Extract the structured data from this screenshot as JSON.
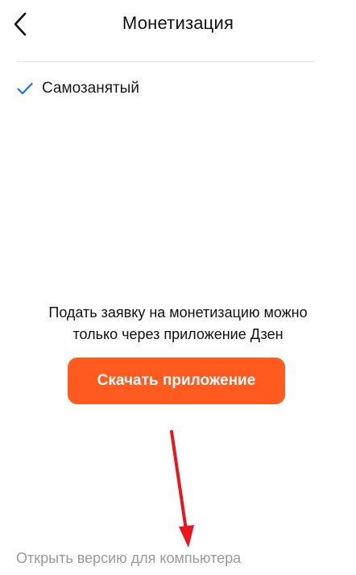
{
  "header": {
    "title": "Монетизация",
    "back_icon": "chevron-left-icon"
  },
  "options": {
    "selected_label": "Самозанятый",
    "check_icon": "checkmark-icon",
    "check_color": "#1a73e8"
  },
  "info": {
    "line1": "Подать заявку на монетизацию можно",
    "line2": "только через приложение Дзен"
  },
  "actions": {
    "download_label": "Скачать приложение",
    "download_color": "#ff5a1f",
    "desktop_link": "Открыть версию для компьютера"
  },
  "annotation": {
    "arrow_icon": "red-arrow-annotation",
    "arrow_color": "#e8141e"
  }
}
